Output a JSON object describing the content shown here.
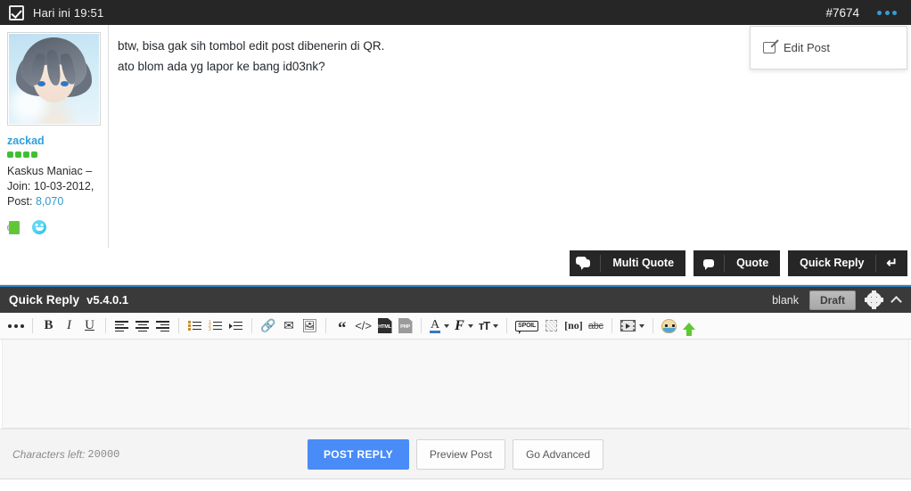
{
  "topbar": {
    "check_icon": "checkbox-checked-icon",
    "title": "Hari ini 19:51",
    "post_number": "#7674",
    "menu_icon": "ellipsis-icon"
  },
  "post": {
    "user": {
      "avatar_alt": "user-avatar",
      "username": "zackad",
      "reputation_dots": 4,
      "reputation_color": "#3fbf33",
      "title": "Kaskus Maniac –",
      "join_label": "Join: 10-03-2012,",
      "post_label": "Post:",
      "post_count": "8,070",
      "badges": [
        {
          "name": "mug-badge-icon"
        },
        {
          "name": "smiley-badge-icon"
        }
      ]
    },
    "body_text": "btw, bisa gak sih tombol edit post dibenerin di QR.\nato blom ada yg lapor ke bang id03nk?",
    "dropdown": {
      "items": [
        {
          "icon": "edit-pencil-icon",
          "label": "Edit Post"
        }
      ]
    },
    "actions": [
      {
        "name": "multi-quote",
        "icon": "double-speech-bubble-icon",
        "label": "Multi Quote"
      },
      {
        "name": "quote",
        "icon": "speech-bubble-icon",
        "label": "Quote"
      },
      {
        "name": "quick-reply",
        "label": "Quick Reply",
        "icon": "return-arrow-icon",
        "icon_glyph": "↵"
      }
    ]
  },
  "quick_reply": {
    "title": "Quick Reply",
    "version": "v5.4.0.1",
    "status_label": "blank",
    "draft_button": "Draft",
    "gear_icon": "gear-icon",
    "collapse_icon": "chevron-up-icon",
    "toolbar": [
      {
        "name": "more-options-icon",
        "type": "dots"
      },
      {
        "type": "sep"
      },
      {
        "name": "bold-icon",
        "type": "text",
        "glyph": "B",
        "style": "serif-bold"
      },
      {
        "name": "italic-icon",
        "type": "text",
        "glyph": "I",
        "style": "serif-italic"
      },
      {
        "name": "underline-icon",
        "type": "text",
        "glyph": "U",
        "style": "serif-underline"
      },
      {
        "type": "sep"
      },
      {
        "name": "align-left-icon",
        "type": "align",
        "variant": "left"
      },
      {
        "name": "align-center-icon",
        "type": "align",
        "variant": "center"
      },
      {
        "name": "align-right-icon",
        "type": "align",
        "variant": "right"
      },
      {
        "type": "sep"
      },
      {
        "name": "bullet-list-icon",
        "type": "bullet"
      },
      {
        "name": "numbered-list-icon",
        "type": "number"
      },
      {
        "name": "indent-icon",
        "type": "indent"
      },
      {
        "type": "sep"
      },
      {
        "name": "link-icon",
        "type": "glyph",
        "glyph": "🔗"
      },
      {
        "name": "email-icon",
        "type": "glyph",
        "glyph": "✉"
      },
      {
        "name": "image-icon",
        "type": "glyph",
        "glyph": "🖼"
      },
      {
        "type": "sep"
      },
      {
        "name": "quote-icon",
        "type": "glyph",
        "glyph": "“"
      },
      {
        "name": "code-icon",
        "type": "glyph",
        "glyph": "‹›"
      },
      {
        "name": "html-file-icon",
        "type": "file",
        "label": "HTML"
      },
      {
        "name": "php-file-icon",
        "type": "file",
        "label": "PHP",
        "variant": "php"
      },
      {
        "type": "sep"
      },
      {
        "name": "font-color-icon",
        "type": "colorA",
        "glyph": "A",
        "caret": true
      },
      {
        "name": "font-family-icon",
        "type": "fontF",
        "glyph": "F",
        "caret": true
      },
      {
        "name": "font-size-icon",
        "type": "fontsize",
        "glyph": "ᴛT",
        "caret": true
      },
      {
        "type": "sep"
      },
      {
        "name": "spoiler-icon",
        "type": "spoil",
        "label": "SPOIL"
      },
      {
        "name": "hide-icon",
        "type": "dotbox"
      },
      {
        "name": "noparse-icon",
        "type": "text",
        "glyph": "[no]",
        "style": "serif-bold-small"
      },
      {
        "name": "strikethrough-icon",
        "type": "strike",
        "glyph": "abc"
      },
      {
        "type": "sep"
      },
      {
        "name": "video-icon",
        "type": "video",
        "caret": true
      },
      {
        "type": "sep"
      },
      {
        "name": "emoticon-icon",
        "type": "emoticon"
      },
      {
        "name": "upload-icon",
        "type": "uparrow"
      }
    ],
    "editor": {
      "value": "",
      "placeholder": ""
    },
    "footer": {
      "chars_label": "Characters left:",
      "chars_count": "20000",
      "buttons": [
        {
          "name": "post-reply-button",
          "label": "POST REPLY",
          "style": "primary"
        },
        {
          "name": "preview-post-button",
          "label": "Preview Post",
          "style": "light"
        },
        {
          "name": "go-advanced-button",
          "label": "Go Advanced",
          "style": "light"
        }
      ]
    }
  },
  "colors": {
    "topbar_bg": "#262626",
    "accent_blue": "#2f9fd8",
    "primary_button": "#4a8cf7",
    "qr_header_bg": "#3a3a3a",
    "qr_top_border": "#2f7ebd",
    "rep_green": "#3fbf33"
  }
}
